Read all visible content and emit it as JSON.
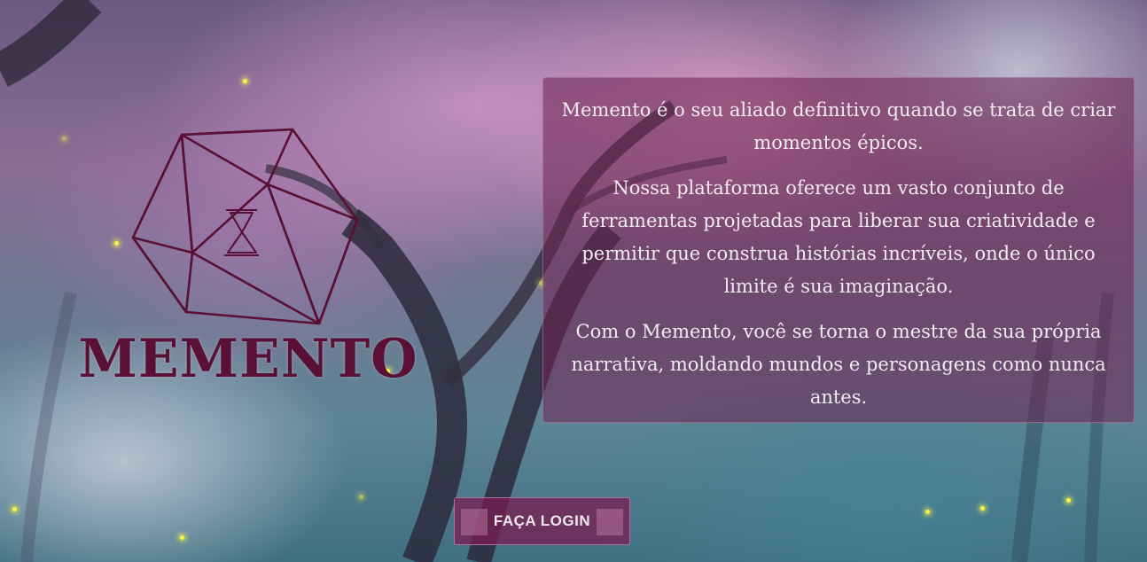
{
  "brand": {
    "name": "MEMENTO",
    "color": "#5a0f35"
  },
  "intro": {
    "paragraphs": [
      "Memento é o seu aliado definitivo quando se trata de criar momentos épicos.",
      "Nossa plataforma oferece um vasto conjunto de ferramentas projetadas para liberar sua criatividade e permitir que construa histórias incríveis, onde o único limite é sua imaginação.",
      "Com o Memento, você se torna o mestre da sua própria narrativa, moldando mundos e personagens como nunca antes."
    ]
  },
  "login_button": {
    "label": "FAÇA LOGIN"
  },
  "colors": {
    "panel_bg": "#6e2350",
    "button_bg": "#781e50",
    "firefly": "#f4f24a"
  },
  "icons": {
    "logo": "d20-hourglass-icon"
  }
}
